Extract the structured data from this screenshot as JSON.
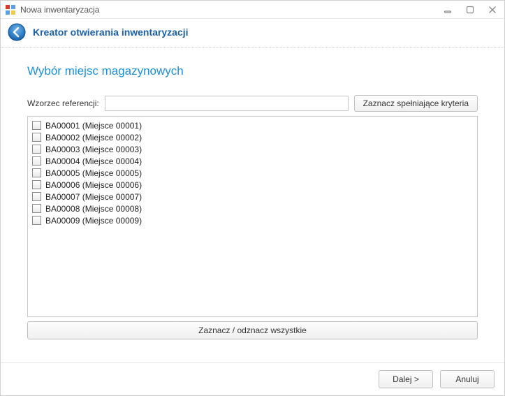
{
  "window": {
    "title": "Nowa inwentaryzacja"
  },
  "wizard": {
    "title": "Kreator otwierania inwentaryzacji"
  },
  "section": {
    "title": "Wybór miejsc magazynowych"
  },
  "filter": {
    "label": "Wzorzec referencji:",
    "value": "",
    "apply_label": "Zaznacz spełniające kryteria"
  },
  "list": {
    "items": [
      {
        "label": "BA00001 (Miejsce 00001)"
      },
      {
        "label": "BA00002 (Miejsce 00002)"
      },
      {
        "label": "BA00003 (Miejsce 00003)"
      },
      {
        "label": "BA00004 (Miejsce 00004)"
      },
      {
        "label": "BA00005 (Miejsce 00005)"
      },
      {
        "label": "BA00006 (Miejsce 00006)"
      },
      {
        "label": "BA00007 (Miejsce 00007)"
      },
      {
        "label": "BA00008 (Miejsce 00008)"
      },
      {
        "label": "BA00009 (Miejsce 00009)"
      }
    ]
  },
  "toggle_all_label": "Zaznacz / odznacz wszystkie",
  "footer": {
    "next_label": "Dalej >",
    "cancel_label": "Anuluj"
  }
}
